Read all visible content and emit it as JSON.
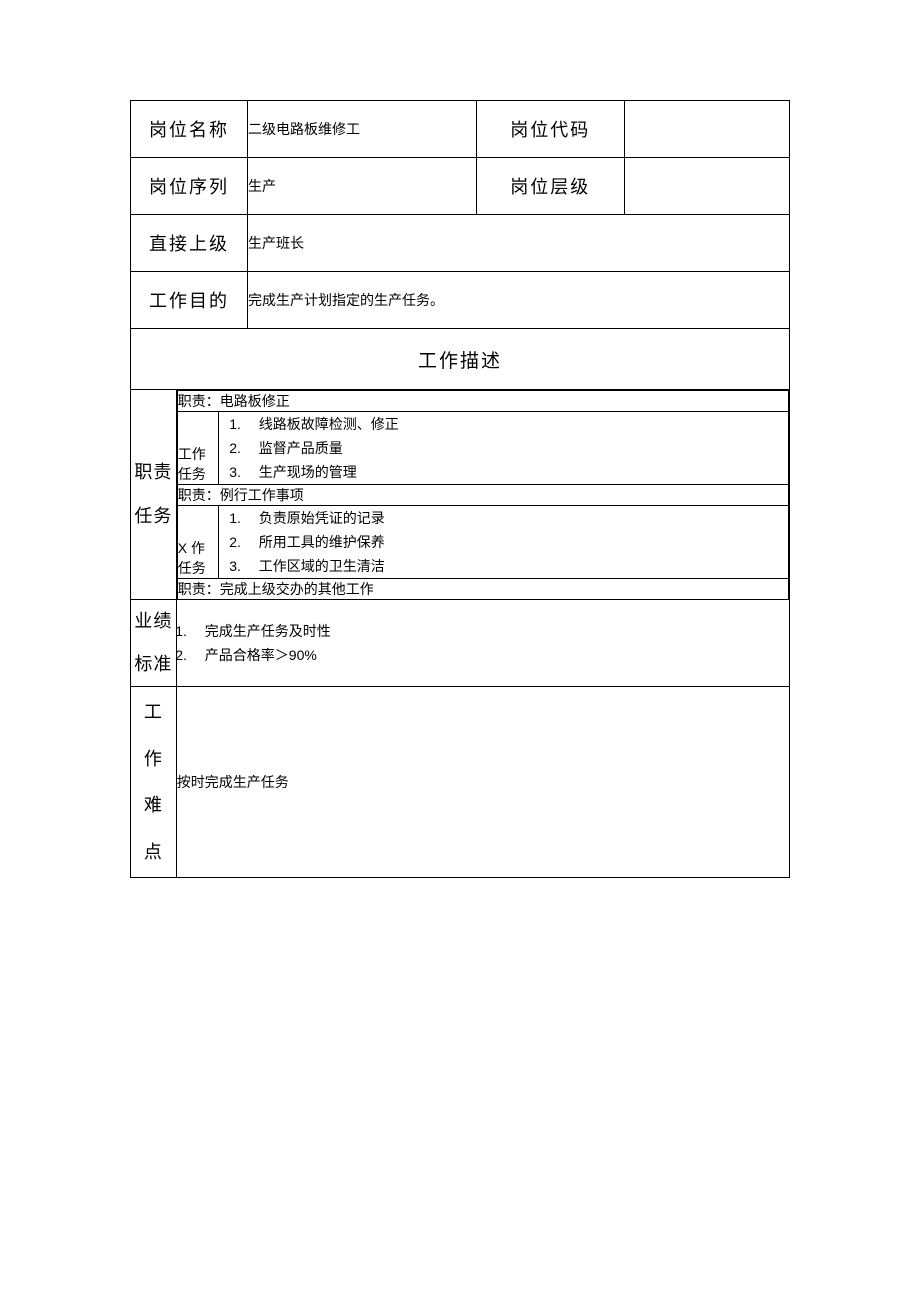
{
  "header": {
    "position_name_label": "岗位名称",
    "position_name_value": "二级电路板维修工",
    "position_code_label": "岗位代码",
    "position_code_value": "",
    "position_series_label": "岗位序列",
    "position_series_value": "生产",
    "position_level_label": "岗位层级",
    "position_level_value": "",
    "direct_supervisor_label": "直接上级",
    "direct_supervisor_value": "生产班长",
    "work_purpose_label": "工作目的",
    "work_purpose_value": "完成生产计划指定的生产任务。"
  },
  "section_title": "工作描述",
  "duties": {
    "label_line1": "职责",
    "label_line2": "任务",
    "blocks": [
      {
        "title": "职责：电路板修正",
        "task_label": "工作任务",
        "items": [
          "线路板故障检测、修正",
          "监督产品质量",
          "生产现场的管理"
        ]
      },
      {
        "title": "职责：例行工作事项",
        "task_label": "X 作任务",
        "items": [
          "负责原始凭证的记录",
          "所用工具的维护保养",
          "工作区域的卫生清洁"
        ]
      },
      {
        "title": "职责：完成上级交办的其他工作"
      }
    ]
  },
  "performance": {
    "label_line1": "业绩",
    "label_line2": "标准",
    "items": [
      "完成生产任务及时性",
      "产品合格率＞90%"
    ]
  },
  "difficulty": {
    "label": "工作难点",
    "value": "按时完成生产任务"
  }
}
